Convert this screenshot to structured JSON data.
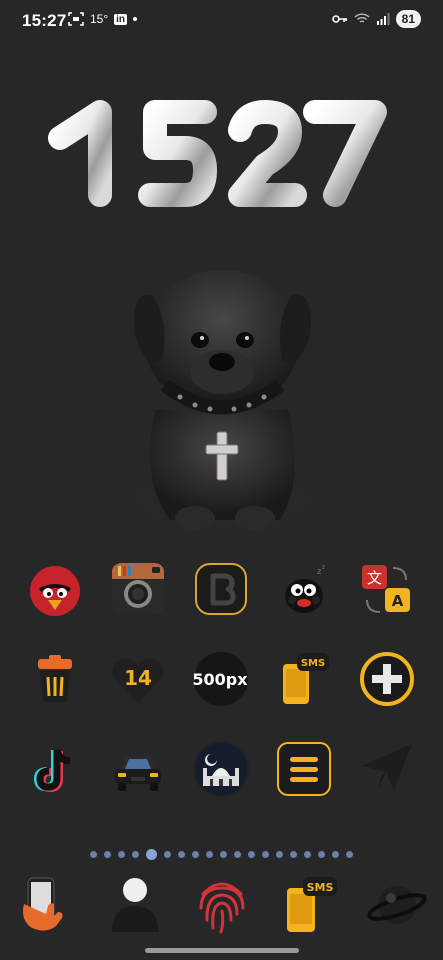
{
  "status_bar": {
    "time": "15:27",
    "temp": "15°",
    "linkedin": "in",
    "battery": "81"
  },
  "clock": {
    "digits": "1527"
  },
  "wallpaper": {
    "subject": "black puppy with cross pendant"
  },
  "app_grid": {
    "rows": [
      [
        {
          "name": "angry-bird-icon"
        },
        {
          "name": "instagram-icon"
        },
        {
          "name": "blogger-icon"
        },
        {
          "name": "monster-icon"
        },
        {
          "name": "translate-icon",
          "glyphs": [
            "文",
            "A"
          ]
        }
      ],
      [
        {
          "name": "trash-icon"
        },
        {
          "name": "fourteen-heart-icon",
          "label": "14"
        },
        {
          "name": "500px-icon",
          "label": "500px"
        },
        {
          "name": "sms-phone-icon",
          "label": "SMS"
        },
        {
          "name": "plus-cross-icon"
        }
      ],
      [
        {
          "name": "tiktok-icon"
        },
        {
          "name": "car-icon"
        },
        {
          "name": "mosque-icon"
        },
        {
          "name": "menu-lines-icon"
        },
        {
          "name": "paper-plane-icon"
        }
      ]
    ]
  },
  "page_indicator": {
    "count": 19,
    "active_index": 4
  },
  "dock": {
    "items": [
      {
        "name": "phone-hand-icon"
      },
      {
        "name": "contacts-person-icon"
      },
      {
        "name": "fingerprint-icon"
      },
      {
        "name": "sms-dock-icon",
        "label": "SMS"
      },
      {
        "name": "planet-icon"
      }
    ]
  },
  "colors": {
    "background": "#272727",
    "accent_yellow": "#f2b31f",
    "page_dot": "#6a7fab"
  }
}
